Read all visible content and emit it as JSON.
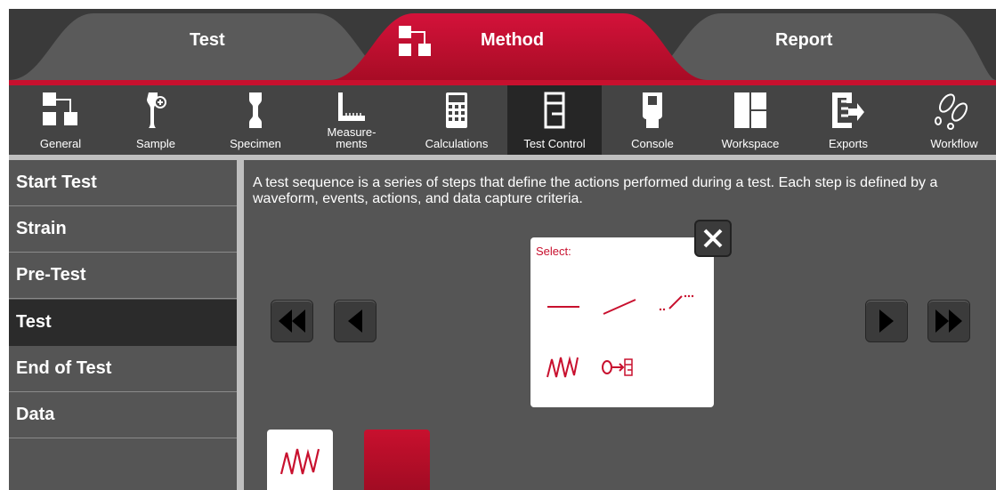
{
  "tabs": [
    {
      "label": "Test",
      "active": false
    },
    {
      "label": "Method",
      "active": true,
      "icon": "method-blocks-icon"
    },
    {
      "label": "Report",
      "active": false
    }
  ],
  "toolbar": [
    {
      "label": "General",
      "icon": "general-blocks-icon"
    },
    {
      "label": "Sample",
      "icon": "sample-icon"
    },
    {
      "label": "Specimen",
      "icon": "specimen-icon"
    },
    {
      "label": "Measure-\nments",
      "icon": "measurements-icon"
    },
    {
      "label": "Calculations",
      "icon": "calculator-icon"
    },
    {
      "label": "Test Control",
      "icon": "test-control-icon",
      "active": true
    },
    {
      "label": "Console",
      "icon": "console-icon"
    },
    {
      "label": "Workspace",
      "icon": "workspace-icon"
    },
    {
      "label": "Exports",
      "icon": "exports-icon"
    },
    {
      "label": "Workflow",
      "icon": "workflow-icon"
    }
  ],
  "sidebar": [
    {
      "label": "Start Test"
    },
    {
      "label": "Strain"
    },
    {
      "label": "Pre-Test"
    },
    {
      "label": "Test",
      "active": true
    },
    {
      "label": "End of Test"
    },
    {
      "label": "Data"
    }
  ],
  "main": {
    "description": "A test sequence is a series of steps that define the actions performed during a test.  Each step is defined by a waveform, events, actions, and data capture criteria."
  },
  "popup": {
    "label": "Select:",
    "options": [
      "hold-waveform-icon",
      "ramp-waveform-icon",
      "profile-waveform-icon",
      "cyclic-waveform-icon",
      "go-to-step-icon"
    ]
  },
  "colors": {
    "accent": "#c8102e",
    "panel": "#555555",
    "dark": "#2b2b2b",
    "text": "#ffffff"
  }
}
